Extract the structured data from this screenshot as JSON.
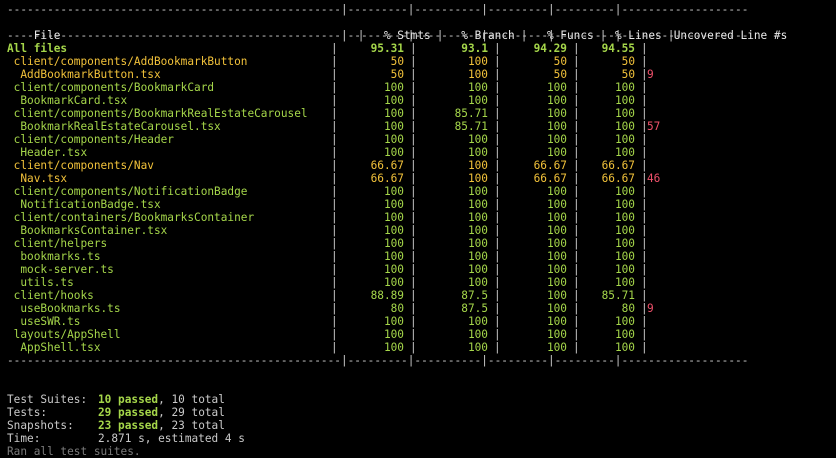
{
  "colors": {
    "background": "#000000",
    "text": "#c9c9c9",
    "high": "#a5d64a",
    "medium": "#f2c23a",
    "uncovered": "#f0516b",
    "dim": "#7b7b7b"
  },
  "table": {
    "separator_line": "--------------------------------------------------|---------|----------|---------|---------|-------------------",
    "headers": {
      "file": "File",
      "stmts": "% Stmts",
      "branch": "% Branch",
      "funcs": "% Funcs",
      "lines": "% Lines",
      "uncovered": "Uncovered Line #s"
    },
    "rows": [
      {
        "file": "All files",
        "stmts": "95.31",
        "branch": "93.1",
        "funcs": "94.29",
        "lines": "94.55",
        "uncovered": "",
        "level": "green"
      },
      {
        "file": " client/components/AddBookmarkButton",
        "stmts": "50",
        "branch": "100",
        "funcs": "50",
        "lines": "50",
        "uncovered": "",
        "level": "yellow"
      },
      {
        "file": "  AddBookmarkButton.tsx",
        "stmts": "50",
        "branch": "100",
        "funcs": "50",
        "lines": "50",
        "uncovered": "9",
        "level": "yellow"
      },
      {
        "file": " client/components/BookmarkCard",
        "stmts": "100",
        "branch": "100",
        "funcs": "100",
        "lines": "100",
        "uncovered": "",
        "level": "green"
      },
      {
        "file": "  BookmarkCard.tsx",
        "stmts": "100",
        "branch": "100",
        "funcs": "100",
        "lines": "100",
        "uncovered": "",
        "level": "green"
      },
      {
        "file": " client/components/BookmarkRealEstateCarousel",
        "stmts": "100",
        "branch": "85.71",
        "funcs": "100",
        "lines": "100",
        "uncovered": "",
        "level": "green"
      },
      {
        "file": "  BookmarkRealEstateCarousel.tsx",
        "stmts": "100",
        "branch": "85.71",
        "funcs": "100",
        "lines": "100",
        "uncovered": "57",
        "level": "green"
      },
      {
        "file": " client/components/Header",
        "stmts": "100",
        "branch": "100",
        "funcs": "100",
        "lines": "100",
        "uncovered": "",
        "level": "green"
      },
      {
        "file": "  Header.tsx",
        "stmts": "100",
        "branch": "100",
        "funcs": "100",
        "lines": "100",
        "uncovered": "",
        "level": "green"
      },
      {
        "file": " client/components/Nav",
        "stmts": "66.67",
        "branch": "100",
        "funcs": "66.67",
        "lines": "66.67",
        "uncovered": "",
        "level": "yellow"
      },
      {
        "file": "  Nav.tsx",
        "stmts": "66.67",
        "branch": "100",
        "funcs": "66.67",
        "lines": "66.67",
        "uncovered": "46",
        "level": "yellow"
      },
      {
        "file": " client/components/NotificationBadge",
        "stmts": "100",
        "branch": "100",
        "funcs": "100",
        "lines": "100",
        "uncovered": "",
        "level": "green"
      },
      {
        "file": "  NotificationBadge.tsx",
        "stmts": "100",
        "branch": "100",
        "funcs": "100",
        "lines": "100",
        "uncovered": "",
        "level": "green"
      },
      {
        "file": " client/containers/BookmarksContainer",
        "stmts": "100",
        "branch": "100",
        "funcs": "100",
        "lines": "100",
        "uncovered": "",
        "level": "green"
      },
      {
        "file": "  BookmarksContainer.tsx",
        "stmts": "100",
        "branch": "100",
        "funcs": "100",
        "lines": "100",
        "uncovered": "",
        "level": "green"
      },
      {
        "file": " client/helpers",
        "stmts": "100",
        "branch": "100",
        "funcs": "100",
        "lines": "100",
        "uncovered": "",
        "level": "green"
      },
      {
        "file": "  bookmarks.ts",
        "stmts": "100",
        "branch": "100",
        "funcs": "100",
        "lines": "100",
        "uncovered": "",
        "level": "green"
      },
      {
        "file": "  mock-server.ts",
        "stmts": "100",
        "branch": "100",
        "funcs": "100",
        "lines": "100",
        "uncovered": "",
        "level": "green"
      },
      {
        "file": "  utils.ts",
        "stmts": "100",
        "branch": "100",
        "funcs": "100",
        "lines": "100",
        "uncovered": "",
        "level": "green"
      },
      {
        "file": " client/hooks",
        "stmts": "88.89",
        "branch": "87.5",
        "funcs": "100",
        "lines": "85.71",
        "uncovered": "",
        "level": "green"
      },
      {
        "file": "  useBookmarks.ts",
        "stmts": "80",
        "branch": "87.5",
        "funcs": "100",
        "lines": "80",
        "uncovered": "9",
        "level": "green"
      },
      {
        "file": "  useSWR.ts",
        "stmts": "100",
        "branch": "100",
        "funcs": "100",
        "lines": "100",
        "uncovered": "",
        "level": "green"
      },
      {
        "file": " layouts/AppShell",
        "stmts": "100",
        "branch": "100",
        "funcs": "100",
        "lines": "100",
        "uncovered": "",
        "level": "green"
      },
      {
        "file": "  AppShell.tsx",
        "stmts": "100",
        "branch": "100",
        "funcs": "100",
        "lines": "100",
        "uncovered": "",
        "level": "green"
      }
    ]
  },
  "summary": {
    "suites_label": "Test Suites:",
    "suites_passed": "10 passed",
    "suites_total": ", 10 total",
    "tests_label": "Tests:",
    "tests_passed": "29 passed",
    "tests_total": ", 29 total",
    "snapshots_label": "Snapshots:",
    "snapshots_passed": "23 passed",
    "snapshots_total": ", 23 total",
    "time_label": "Time:",
    "time_value": "2.871 s, estimated 4 s",
    "footer": "Ran all test suites."
  }
}
